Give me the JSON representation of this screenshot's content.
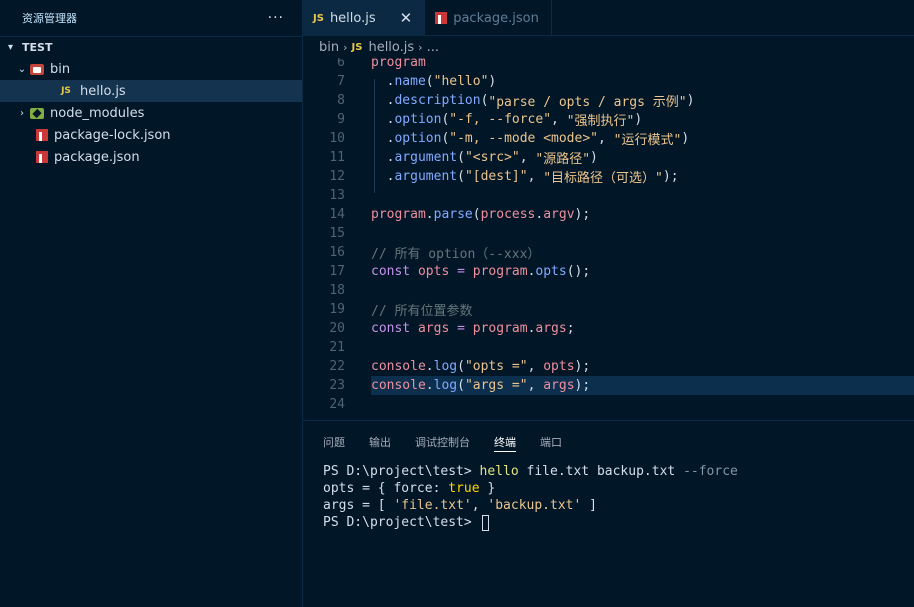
{
  "sidebar": {
    "title": "资源管理器",
    "more_label": "···",
    "section_label": "TEST",
    "items": [
      {
        "label": "bin",
        "icon": "folder-bin-icon",
        "expanded": true
      },
      {
        "label": "hello.js",
        "icon": "js-file-icon",
        "selected": true
      },
      {
        "label": "node_modules",
        "icon": "folder-node-icon",
        "expanded": false
      },
      {
        "label": "package-lock.json",
        "icon": "npm-file-icon"
      },
      {
        "label": "package.json",
        "icon": "npm-file-icon"
      }
    ]
  },
  "tabs": [
    {
      "label": "hello.js",
      "icon": "js-file-icon",
      "active": true
    },
    {
      "label": "package.json",
      "icon": "npm-file-icon",
      "active": false
    }
  ],
  "breadcrumb": {
    "folder": "bin",
    "file": "hello.js",
    "trail": "..."
  },
  "editor": {
    "current_line": 23,
    "lines": [
      {
        "n": "6",
        "tokens": [
          [
            "program",
            "t-var"
          ]
        ]
      },
      {
        "n": "7",
        "tokens": [
          [
            "  .",
            "t-punc"
          ],
          [
            "name",
            "t-fn"
          ],
          [
            "(",
            "t-punc"
          ],
          [
            "\"hello\"",
            "t-str"
          ],
          [
            ")",
            "t-punc"
          ]
        ]
      },
      {
        "n": "8",
        "tokens": [
          [
            "  .",
            "t-punc"
          ],
          [
            "description",
            "t-fn"
          ],
          [
            "(",
            "t-punc"
          ],
          [
            "\"parse / opts / args 示例\"",
            "t-str"
          ],
          [
            ")",
            "t-punc"
          ]
        ]
      },
      {
        "n": "9",
        "tokens": [
          [
            "  .",
            "t-punc"
          ],
          [
            "option",
            "t-fn"
          ],
          [
            "(",
            "t-punc"
          ],
          [
            "\"-f, --force\"",
            "t-str"
          ],
          [
            ", ",
            "t-punc"
          ],
          [
            "\"强制执行\"",
            "t-str"
          ],
          [
            ")",
            "t-punc"
          ]
        ]
      },
      {
        "n": "10",
        "tokens": [
          [
            "  .",
            "t-punc"
          ],
          [
            "option",
            "t-fn"
          ],
          [
            "(",
            "t-punc"
          ],
          [
            "\"-m, --mode <mode>\"",
            "t-str"
          ],
          [
            ", ",
            "t-punc"
          ],
          [
            "\"运行模式\"",
            "t-str"
          ],
          [
            ")",
            "t-punc"
          ]
        ]
      },
      {
        "n": "11",
        "tokens": [
          [
            "  .",
            "t-punc"
          ],
          [
            "argument",
            "t-fn"
          ],
          [
            "(",
            "t-punc"
          ],
          [
            "\"<src>\"",
            "t-str"
          ],
          [
            ", ",
            "t-punc"
          ],
          [
            "\"源路径\"",
            "t-str"
          ],
          [
            ")",
            "t-punc"
          ]
        ]
      },
      {
        "n": "12",
        "tokens": [
          [
            "  .",
            "t-punc"
          ],
          [
            "argument",
            "t-fn"
          ],
          [
            "(",
            "t-punc"
          ],
          [
            "\"[dest]\"",
            "t-str"
          ],
          [
            ", ",
            "t-punc"
          ],
          [
            "\"目标路径（可选）\"",
            "t-str"
          ],
          [
            ");",
            "t-punc"
          ]
        ]
      },
      {
        "n": "13",
        "tokens": []
      },
      {
        "n": "14",
        "tokens": [
          [
            "program",
            "t-var"
          ],
          [
            ".",
            "t-punc"
          ],
          [
            "parse",
            "t-fn"
          ],
          [
            "(",
            "t-punc"
          ],
          [
            "process",
            "t-var"
          ],
          [
            ".",
            "t-punc"
          ],
          [
            "argv",
            "t-var"
          ],
          [
            ");",
            "t-punc"
          ]
        ]
      },
      {
        "n": "15",
        "tokens": []
      },
      {
        "n": "16",
        "tokens": [
          [
            "// 所有 option（--xxx）",
            "t-com"
          ]
        ]
      },
      {
        "n": "17",
        "tokens": [
          [
            "const ",
            "t-kw"
          ],
          [
            "opts",
            "t-var"
          ],
          [
            " = ",
            "t-kw"
          ],
          [
            "program",
            "t-var"
          ],
          [
            ".",
            "t-punc"
          ],
          [
            "opts",
            "t-fn"
          ],
          [
            "();",
            "t-punc"
          ]
        ]
      },
      {
        "n": "18",
        "tokens": []
      },
      {
        "n": "19",
        "tokens": [
          [
            "// 所有位置参数",
            "t-com"
          ]
        ]
      },
      {
        "n": "20",
        "tokens": [
          [
            "const ",
            "t-kw"
          ],
          [
            "args",
            "t-var"
          ],
          [
            " = ",
            "t-kw"
          ],
          [
            "program",
            "t-var"
          ],
          [
            ".",
            "t-punc"
          ],
          [
            "args",
            "t-var"
          ],
          [
            ";",
            "t-punc"
          ]
        ]
      },
      {
        "n": "21",
        "tokens": []
      },
      {
        "n": "22",
        "tokens": [
          [
            "console",
            "t-var"
          ],
          [
            ".",
            "t-punc"
          ],
          [
            "log",
            "t-fn"
          ],
          [
            "(",
            "t-punc"
          ],
          [
            "\"opts =\"",
            "t-str"
          ],
          [
            ", ",
            "t-punc"
          ],
          [
            "opts",
            "t-var"
          ],
          [
            ");",
            "t-punc"
          ]
        ]
      },
      {
        "n": "23",
        "tokens": [
          [
            "console",
            "t-var"
          ],
          [
            ".",
            "t-punc"
          ],
          [
            "log",
            "t-fn"
          ],
          [
            "(",
            "t-punc"
          ],
          [
            "\"args =\"",
            "t-str"
          ],
          [
            ", ",
            "t-punc"
          ],
          [
            "args",
            "t-var"
          ],
          [
            ");",
            "t-punc"
          ]
        ]
      },
      {
        "n": "24",
        "tokens": []
      }
    ]
  },
  "panel": {
    "tabs": [
      {
        "label": "问题",
        "active": false
      },
      {
        "label": "输出",
        "active": false
      },
      {
        "label": "调试控制台",
        "active": false
      },
      {
        "label": "终端",
        "active": true
      },
      {
        "label": "端口",
        "active": false
      }
    ],
    "terminal": {
      "prompt": "PS D:\\project\\test> ",
      "command": "hello",
      "args": " file.txt backup.txt ",
      "flag": "--force",
      "opts_prefix": "opts = { force: ",
      "opts_value": "true",
      "opts_suffix": " }",
      "args_prefix": "args = [ ",
      "args_item1": "'file.txt'",
      "args_sep": ", ",
      "args_item2": "'backup.txt'",
      "args_suffix": " ]",
      "prompt2": "PS D:\\project\\test> "
    }
  },
  "colors": {
    "background": "#011627",
    "accent_tab": "#0b2942",
    "current_line": "#0c2f4e"
  }
}
